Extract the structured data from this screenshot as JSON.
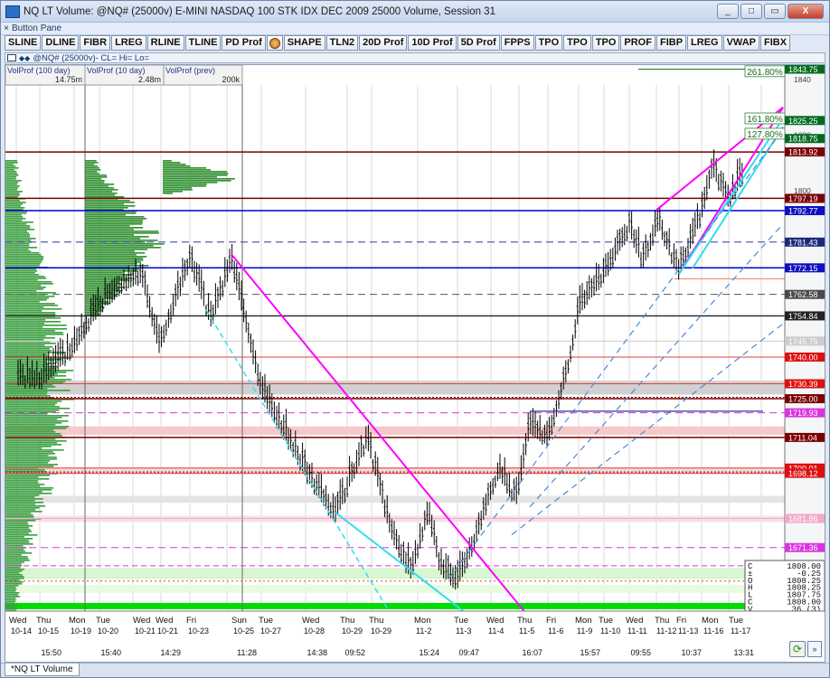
{
  "window": {
    "title": "NQ LT Volume: @NQ# (25000v) E-MINI NASDAQ 100 STK IDX DEC 2009 25000 Volume, Session 31",
    "buttons": [
      "_",
      "□",
      "▭",
      "X"
    ]
  },
  "button_pane": {
    "label": "Button Pane",
    "close": "×"
  },
  "toolbar": [
    "SLINE",
    "DLINE",
    "FIBR",
    "LREG",
    "RLINE",
    "TLINE",
    "PD Prof",
    "",
    "SHAPE",
    "TLN2",
    "20D Prof",
    "10D Prof",
    "5D Prof",
    "FPPS",
    "TPO",
    "TPO",
    "TPO",
    "PROF",
    "FIBP",
    "LREG",
    "VWAP",
    "FIBX"
  ],
  "chart_strip": {
    "label": "@NQ# (25000v)- CL= Hi= Lo="
  },
  "profiles": [
    {
      "name": "VolProf (100 day)",
      "value": "14.75m"
    },
    {
      "name": "VolProf (10 day)",
      "value": "2.48m"
    },
    {
      "name": "VolProf (prev)",
      "value": "200k"
    }
  ],
  "colors": {
    "price_candles": "#000000",
    "magenta_line": "#ff00ff",
    "cyan_line": "#33ddee",
    "blue_line": "#0000cc",
    "dark_red_line": "#800000",
    "profile_green": "#2f9a44",
    "red_label": "#cc0000",
    "bright_green_band": "#00dd00"
  },
  "price_axis": {
    "ticks": [
      "1840",
      "1820",
      "1800"
    ],
    "labels": [
      {
        "text": "1843.75",
        "style": "darkgreen",
        "price": 1843.75
      },
      {
        "text": "1825.25",
        "style": "darkgreen",
        "price": 1825.25
      },
      {
        "text": "1818.75",
        "style": "darkgreen",
        "price": 1818.75
      },
      {
        "text": "1813.92",
        "style": "darkred",
        "price": 1813.92
      },
      {
        "text": "1797.19",
        "style": "darkred",
        "price": 1797.19
      },
      {
        "text": "1792.77",
        "style": "blue",
        "price": 1792.77
      },
      {
        "text": "1781.43",
        "style": "navy",
        "price": 1781.43
      },
      {
        "text": "1772.15",
        "style": "blue",
        "price": 1772.15
      },
      {
        "text": "1762.58",
        "style": "gray",
        "price": 1762.58
      },
      {
        "text": "1754.84",
        "style": "black",
        "price": 1754.84
      },
      {
        "text": "1745.75",
        "style": "faint",
        "price": 1745.75
      },
      {
        "text": "1740.00",
        "style": "red",
        "price": 1740.0
      },
      {
        "text": "1730.39",
        "style": "red",
        "price": 1730.39
      },
      {
        "text": "1725.00",
        "style": "darkred",
        "price": 1725.0
      },
      {
        "text": "1719.93",
        "style": "magenta",
        "price": 1719.93
      },
      {
        "text": "1711.04",
        "style": "darkred",
        "price": 1711.04
      },
      {
        "text": "1700.01",
        "style": "red",
        "price": 1700.01
      },
      {
        "text": "1698.12",
        "style": "red",
        "price": 1698.12
      },
      {
        "text": "1681.86",
        "style": "faintpink",
        "price": 1681.86
      },
      {
        "text": "1671.36",
        "style": "magenta",
        "price": 1671.36
      }
    ]
  },
  "fib_labels": [
    "261.80%",
    "161.80%",
    "127.80%"
  ],
  "data_box": [
    {
      "k": "C",
      "v": "1808.00"
    },
    {
      "k": "±",
      "v": "-0.25"
    },
    {
      "k": "O",
      "v": "1808.25"
    },
    {
      "k": "H",
      "v": "1808.25"
    },
    {
      "k": "L",
      "v": "1807.75"
    },
    {
      "k": "C",
      "v": "1808.00"
    },
    {
      "k": "V",
      "v": "36 (3)"
    }
  ],
  "date_axis": [
    {
      "day": "Wed",
      "date": "10-14",
      "time": ""
    },
    {
      "day": "Thu",
      "date": "10-15",
      "time": "15:50"
    },
    {
      "day": "Mon",
      "date": "10-19",
      "time": ""
    },
    {
      "day": "Tue",
      "date": "10-20",
      "time": "15:40"
    },
    {
      "day": "Wed",
      "date": "10-21",
      "time": ""
    },
    {
      "day": "Wed",
      "date": "10-21",
      "time": "14:29"
    },
    {
      "day": "Fri",
      "date": "10-23",
      "time": ""
    },
    {
      "day": "Sun",
      "date": "10-25",
      "time": "11:28"
    },
    {
      "day": "Tue",
      "date": "10-27",
      "time": ""
    },
    {
      "day": "Wed",
      "date": "10-28",
      "time": "14:38"
    },
    {
      "day": "Thu",
      "date": "10-29",
      "time": "09:52"
    },
    {
      "day": "Thu",
      "date": "10-29",
      "time": ""
    },
    {
      "day": "Mon",
      "date": "11-2",
      "time": "15:24"
    },
    {
      "day": "Tue",
      "date": "11-3",
      "time": "09:47"
    },
    {
      "day": "Wed",
      "date": "11-4",
      "time": ""
    },
    {
      "day": "Thu",
      "date": "11-5",
      "time": "16:07"
    },
    {
      "day": "Fri",
      "date": "11-6",
      "time": ""
    },
    {
      "day": "Mon",
      "date": "11-9",
      "time": "15:57"
    },
    {
      "day": "Tue",
      "date": "11-10",
      "time": ""
    },
    {
      "day": "Wed",
      "date": "11-11",
      "time": "09:55"
    },
    {
      "day": "Thu",
      "date": "11-12",
      "time": ""
    },
    {
      "day": "Fri",
      "date": "11-13",
      "time": "10:37"
    },
    {
      "day": "Mon",
      "date": "11-16",
      "time": ""
    },
    {
      "day": "Tue",
      "date": "11-17",
      "time": "13:31"
    }
  ],
  "status_tab": "*NQ LT Volume"
}
